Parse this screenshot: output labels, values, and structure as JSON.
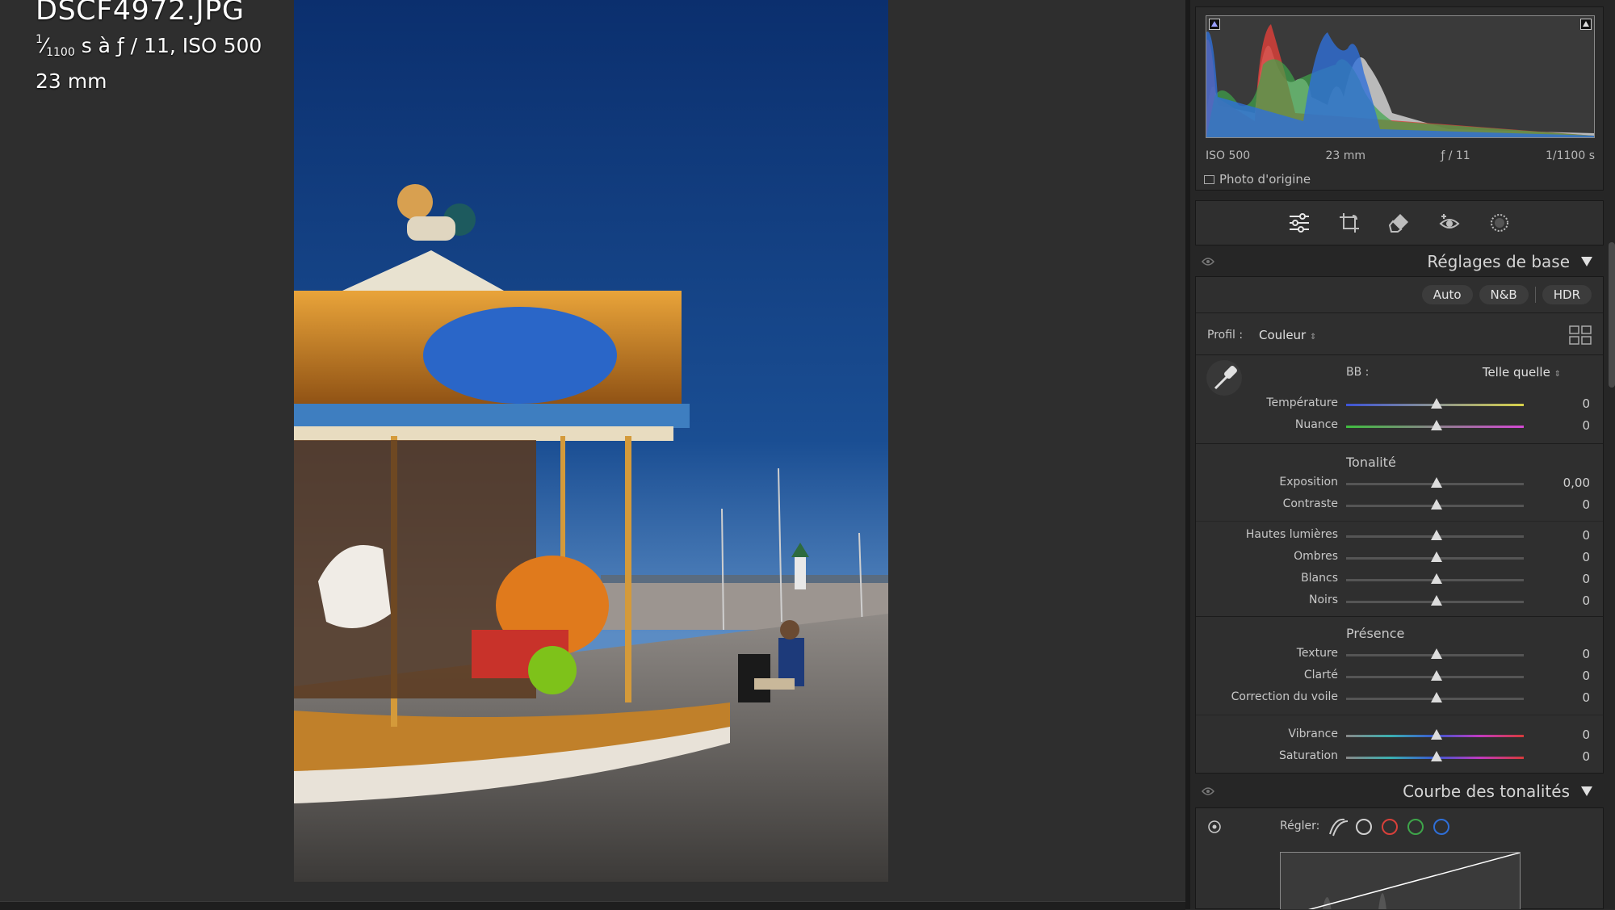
{
  "file_info": {
    "name": "DSCF4972.JPG",
    "shutter_num": "1",
    "shutter_den": "1100",
    "exposure_rest": " s à ƒ / 11, ISO 500",
    "focal": "23 mm"
  },
  "histogram": {
    "iso": "ISO 500",
    "focal": "23 mm",
    "aperture": "ƒ / 11",
    "shutter": "1/1100 s",
    "original_photo_label": "Photo d'origine",
    "colors": {
      "red": "#d8403a",
      "green": "#3ea54a",
      "blue": "#2f6fd8",
      "gray": "#c9c9c9"
    }
  },
  "tools": [
    "sliders-icon",
    "crop-icon",
    "eraser-icon",
    "redeye-icon",
    "mask-icon"
  ],
  "basic": {
    "title": "Réglages de base",
    "btn_auto": "Auto",
    "btn_bw": "N&B",
    "btn_hdr": "HDR",
    "profile_label": "Profil :",
    "profile_value": "Couleur",
    "wb_label": "BB :",
    "wb_value": "Telle quelle",
    "temp": {
      "name": "Température",
      "value": "0",
      "pos": 0.5
    },
    "tint": {
      "name": "Nuance",
      "value": "0",
      "pos": 0.5
    },
    "tone_title": "Tonalité",
    "exposure": {
      "name": "Exposition",
      "value": "0,00",
      "pos": 0.5
    },
    "contrast": {
      "name": "Contraste",
      "value": "0",
      "pos": 0.5
    },
    "highlights": {
      "name": "Hautes lumières",
      "value": "0",
      "pos": 0.5
    },
    "shadows": {
      "name": "Ombres",
      "value": "0",
      "pos": 0.5
    },
    "whites": {
      "name": "Blancs",
      "value": "0",
      "pos": 0.5
    },
    "blacks": {
      "name": "Noirs",
      "value": "0",
      "pos": 0.5
    },
    "presence_title": "Présence",
    "texture": {
      "name": "Texture",
      "value": "0",
      "pos": 0.5
    },
    "clarity": {
      "name": "Clarté",
      "value": "0",
      "pos": 0.5
    },
    "dehaze": {
      "name": "Correction du voile",
      "value": "0",
      "pos": 0.5
    },
    "vibrance": {
      "name": "Vibrance",
      "value": "0",
      "pos": 0.5
    },
    "saturation": {
      "name": "Saturation",
      "value": "0",
      "pos": 0.5
    }
  },
  "curve": {
    "title": "Courbe des tonalités",
    "adjust_label": "Régler:"
  }
}
